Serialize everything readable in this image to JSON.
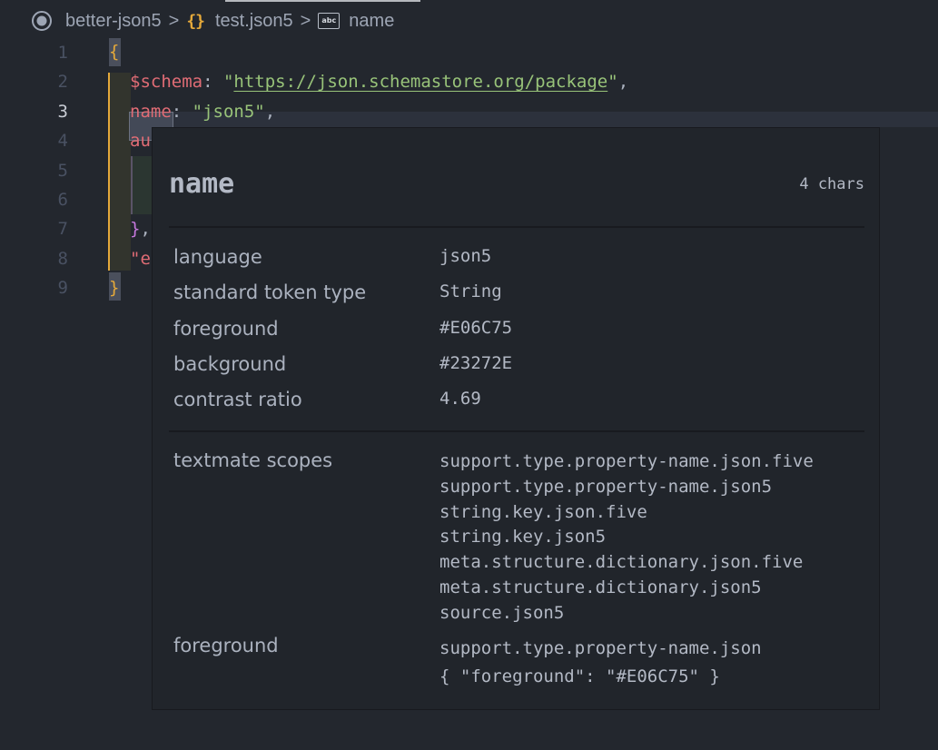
{
  "breadcrumb": {
    "items": [
      {
        "label": "better-json5",
        "icon": "target-icon"
      },
      {
        "label": "test.json5",
        "icon": "braces-icon"
      },
      {
        "label": "name",
        "icon": "abc-string-icon"
      }
    ],
    "separator": ">",
    "abc_glyph": "abc",
    "braces_glyph": "{}"
  },
  "editor": {
    "active_line": 3,
    "line_numbers": [
      "1",
      "2",
      "3",
      "4",
      "5",
      "6",
      "7",
      "8",
      "9"
    ],
    "lines": {
      "l1": {
        "brace": "{"
      },
      "l2": {
        "key": "$schema",
        "colon": ": ",
        "q1": "\"",
        "url": "https://json.schemastore.org/package",
        "q2": "\"",
        "comma": ","
      },
      "l3": {
        "key": "name",
        "colon": ": ",
        "value": "\"json5\"",
        "comma": ","
      },
      "l4": {
        "key": "au"
      },
      "l7": {
        "brace": "}",
        "comma": ","
      },
      "l8": {
        "q": "\"",
        "key": "e"
      },
      "l9": {
        "brace": "}"
      }
    }
  },
  "hover": {
    "token": "name",
    "length": "4 chars",
    "rows": [
      {
        "label": "language",
        "value": "json5"
      },
      {
        "label": "standard token type",
        "value": "String"
      },
      {
        "label": "foreground",
        "value": "#E06C75"
      },
      {
        "label": "background",
        "value": "#23272E"
      },
      {
        "label": "contrast ratio",
        "value": "4.69"
      }
    ],
    "scopes_label": "textmate scopes",
    "scopes": [
      "support.type.property-name.json.five",
      "support.type.property-name.json5",
      "string.key.json.five",
      "string.key.json5",
      "meta.structure.dictionary.json.five",
      "meta.structure.dictionary.json5",
      "source.json5"
    ],
    "fg_rule_label": "foreground",
    "fg_rule_selector": "support.type.property-name.json",
    "fg_rule_value": "{ \"foreground\": \"#E06C75\" }"
  },
  "colors": {
    "key": "#E06C75",
    "string": "#98C379",
    "editor_background": "#23272E",
    "bracket_gold": "#E5A93A",
    "bracket_purple": "#C678DD"
  }
}
